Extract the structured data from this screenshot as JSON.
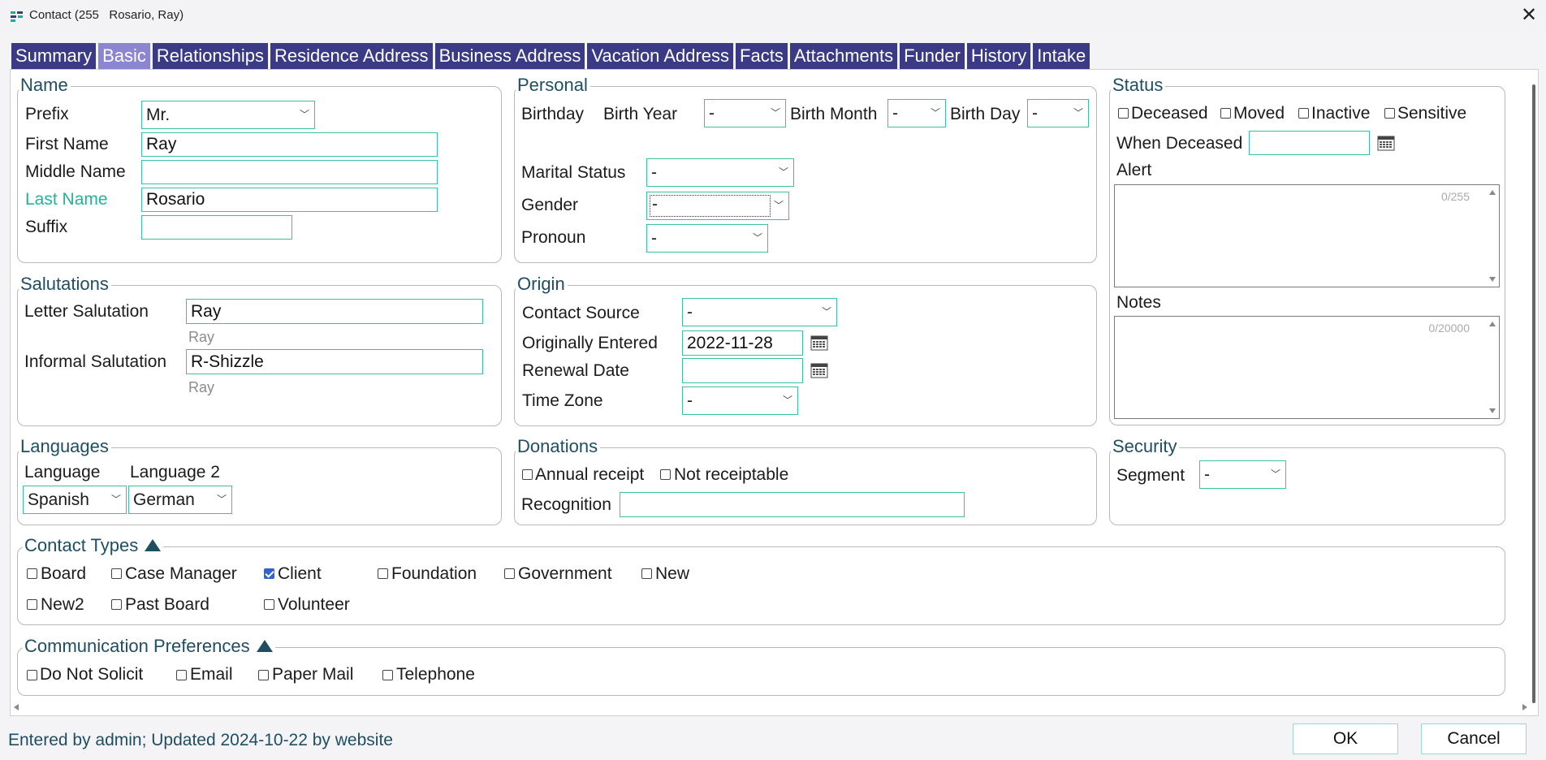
{
  "window": {
    "title": "Contact (255   Rosario, Ray)",
    "close_glyph": "✕"
  },
  "tabs": [
    {
      "label": "Summary",
      "active": false
    },
    {
      "label": "Basic",
      "active": true
    },
    {
      "label": "Relationships",
      "active": false
    },
    {
      "label": "Residence Address",
      "active": false
    },
    {
      "label": "Business Address",
      "active": false
    },
    {
      "label": "Vacation Address",
      "active": false
    },
    {
      "label": "Facts",
      "active": false
    },
    {
      "label": "Attachments",
      "active": false
    },
    {
      "label": "Funder",
      "active": false
    },
    {
      "label": "History",
      "active": false
    },
    {
      "label": "Intake",
      "active": false
    }
  ],
  "name": {
    "title": "Name",
    "prefix_label": "Prefix",
    "prefix_value": "Mr.",
    "first_label": "First Name",
    "first_value": "Ray",
    "middle_label": "Middle Name",
    "middle_value": "",
    "last_label": "Last Name",
    "last_value": "Rosario",
    "suffix_label": "Suffix",
    "suffix_value": ""
  },
  "personal": {
    "title": "Personal",
    "birthday_label": "Birthday",
    "birth_year_label": "Birth Year",
    "birth_year_value": "-",
    "birth_month_label": "Birth Month",
    "birth_month_value": "-",
    "birth_day_label": "Birth Day",
    "birth_day_value": "-",
    "marital_label": "Marital Status",
    "marital_value": "-",
    "gender_label": "Gender",
    "gender_value": "-",
    "pronoun_label": "Pronoun",
    "pronoun_value": "-"
  },
  "status": {
    "title": "Status",
    "deceased": "Deceased",
    "moved": "Moved",
    "inactive": "Inactive",
    "sensitive": "Sensitive",
    "when_deceased_label": "When Deceased",
    "when_deceased_value": "",
    "alert_label": "Alert",
    "alert_count": "0/255",
    "notes_label": "Notes",
    "notes_count": "0/20000"
  },
  "salutations": {
    "title": "Salutations",
    "letter_label": "Letter Salutation",
    "letter_value": "Ray",
    "letter_hint": "Ray",
    "informal_label": "Informal Salutation",
    "informal_value": "R-Shizzle",
    "informal_hint": "Ray"
  },
  "origin": {
    "title": "Origin",
    "source_label": "Contact Source",
    "source_value": "-",
    "entered_label": "Originally Entered",
    "entered_value": "2022-11-28",
    "renewal_label": "Renewal Date",
    "renewal_value": "",
    "timezone_label": "Time Zone",
    "timezone_value": "-"
  },
  "languages": {
    "title": "Languages",
    "language_label": "Language",
    "language_value": "Spanish",
    "language2_label": "Language 2",
    "language2_value": "German"
  },
  "donations": {
    "title": "Donations",
    "annual_receipt": "Annual receipt",
    "not_receiptable": "Not receiptable",
    "recognition_label": "Recognition",
    "recognition_value": ""
  },
  "security": {
    "title": "Security",
    "segment_label": "Segment",
    "segment_value": "-"
  },
  "contact_types": {
    "title": "Contact Types",
    "items": [
      {
        "label": "Board",
        "checked": false
      },
      {
        "label": "Case Manager",
        "checked": false
      },
      {
        "label": "Client",
        "checked": true
      },
      {
        "label": "Foundation",
        "checked": false
      },
      {
        "label": "Government",
        "checked": false
      },
      {
        "label": "New",
        "checked": false
      },
      {
        "label": "New2",
        "checked": false
      },
      {
        "label": "Past Board",
        "checked": false
      },
      {
        "label": "Volunteer",
        "checked": false
      }
    ]
  },
  "communication": {
    "title": "Communication Preferences",
    "items": [
      {
        "label": "Do Not Solicit",
        "checked": false
      },
      {
        "label": "Email",
        "checked": false
      },
      {
        "label": "Paper Mail",
        "checked": false
      },
      {
        "label": "Telephone",
        "checked": false
      }
    ]
  },
  "footer": {
    "status_text": "Entered by admin; Updated 2024-10-22 by website",
    "ok_label": "OK",
    "cancel_label": "Cancel"
  },
  "colors": {
    "tab_bg": "#3a3a86",
    "tab_active_bg": "#8b85d2",
    "field_border": "#3cc0a6",
    "group_title": "#1f4e63",
    "required_label": "#23b398",
    "checkbox_checked": "#2f63d0"
  }
}
